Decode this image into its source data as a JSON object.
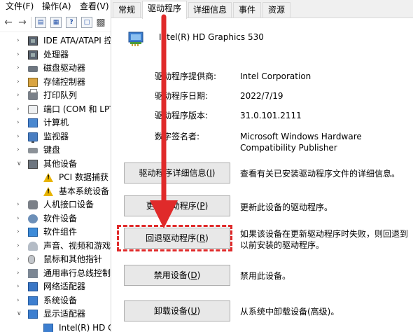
{
  "device_manager": {
    "menu": [
      "文件(F)",
      "操作(A)",
      "查看(V)"
    ],
    "tree": [
      {
        "label": "IDE ATA/ATAPI 控",
        "icon": "ide-controller-icon",
        "indent": 1,
        "caret": "collapsed"
      },
      {
        "label": "处理器",
        "icon": "processor-icon",
        "indent": 1,
        "caret": "collapsed"
      },
      {
        "label": "磁盘驱动器",
        "icon": "disk-drive-icon",
        "indent": 1,
        "caret": "collapsed"
      },
      {
        "label": "存储控制器",
        "icon": "storage-controller-icon",
        "indent": 1,
        "caret": "collapsed"
      },
      {
        "label": "打印队列",
        "icon": "printer-icon",
        "indent": 1,
        "caret": "collapsed"
      },
      {
        "label": "端口 (COM 和 LPT)",
        "icon": "port-icon",
        "indent": 1,
        "caret": "collapsed"
      },
      {
        "label": "计算机",
        "icon": "computer-icon",
        "indent": 1,
        "caret": "collapsed"
      },
      {
        "label": "监视器",
        "icon": "monitor-icon",
        "indent": 1,
        "caret": "collapsed"
      },
      {
        "label": "键盘",
        "icon": "keyboard-icon",
        "indent": 1,
        "caret": "collapsed"
      },
      {
        "label": "其他设备",
        "icon": "other-devices-icon",
        "indent": 1,
        "caret": "expanded"
      },
      {
        "label": "PCI 数据捕获",
        "icon": "warning-device-icon",
        "indent": 2,
        "caret": "none"
      },
      {
        "label": "基本系统设备",
        "icon": "warning-device-icon",
        "indent": 2,
        "caret": "none"
      },
      {
        "label": "人机接口设备",
        "icon": "hid-icon",
        "indent": 1,
        "caret": "collapsed"
      },
      {
        "label": "软件设备",
        "icon": "software-device-icon",
        "indent": 1,
        "caret": "collapsed"
      },
      {
        "label": "软件组件",
        "icon": "software-component-icon",
        "indent": 1,
        "caret": "collapsed"
      },
      {
        "label": "声音、视频和游戏",
        "icon": "audio-icon",
        "indent": 1,
        "caret": "collapsed"
      },
      {
        "label": "鼠标和其他指针",
        "icon": "mouse-icon",
        "indent": 1,
        "caret": "collapsed"
      },
      {
        "label": "通用串行总线控制",
        "icon": "usb-controller-icon",
        "indent": 1,
        "caret": "collapsed"
      },
      {
        "label": "网络适配器",
        "icon": "network-adapter-icon",
        "indent": 1,
        "caret": "collapsed"
      },
      {
        "label": "系统设备",
        "icon": "system-device-icon",
        "indent": 1,
        "caret": "collapsed"
      },
      {
        "label": "显示适配器",
        "icon": "display-adapter-icon",
        "indent": 1,
        "caret": "expanded"
      },
      {
        "label": "Intel(R) HD G",
        "icon": "display-adapter-icon",
        "indent": 2,
        "caret": "none"
      }
    ]
  },
  "properties": {
    "tabs": [
      {
        "label": "常规",
        "active": false
      },
      {
        "label": "驱动程序",
        "active": true
      },
      {
        "label": "详细信息",
        "active": false
      },
      {
        "label": "事件",
        "active": false
      },
      {
        "label": "资源",
        "active": false
      }
    ],
    "device_name": "Intel(R) HD Graphics 530",
    "info": [
      {
        "label": "驱动程序提供商:",
        "value": "Intel Corporation"
      },
      {
        "label": "驱动程序日期:",
        "value": "2022/7/19"
      },
      {
        "label": "驱动程序版本:",
        "value": "31.0.101.2111"
      },
      {
        "label": "数字签名者:",
        "value": "Microsoft Windows Hardware Compatibility Publisher"
      }
    ],
    "buttons": [
      {
        "label": "驱动程序详细信息(",
        "accel": "I",
        "tail": ")",
        "desc": "查看有关已安装驱动程序文件的详细信息。"
      },
      {
        "label": "更新驱动程序(",
        "accel": "P",
        "tail": ")",
        "desc": "更新此设备的驱动程序。"
      },
      {
        "label": "回退驱动程序(",
        "accel": "R",
        "tail": ")",
        "desc": "如果该设备在更新驱动程序时失败，则回退到以前安装的驱动程序。"
      },
      {
        "label": "禁用设备(",
        "accel": "D",
        "tail": ")",
        "desc": "禁用此设备。"
      },
      {
        "label": "卸载设备(",
        "accel": "U",
        "tail": ")",
        "desc": "从系统中卸载设备(高级)。"
      }
    ]
  },
  "annotation": {
    "color": "#e02a2a",
    "target": "回退驱动程序"
  }
}
